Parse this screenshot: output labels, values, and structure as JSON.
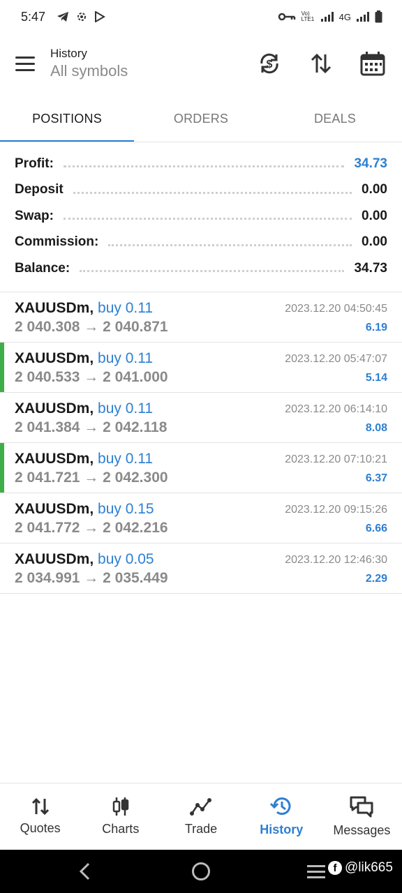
{
  "status_bar": {
    "time": "5:47",
    "network": "4G",
    "volte": "Vo) LTE1",
    "icons": [
      "telegram-icon",
      "settings-icon",
      "play-store-icon",
      "vpn-key-icon",
      "signal-icon",
      "battery-icon"
    ]
  },
  "header": {
    "title": "History",
    "subtitle": "All symbols",
    "actions": [
      "currency-exchange-icon",
      "sort-icon",
      "calendar-icon"
    ]
  },
  "tabs": [
    {
      "label": "POSITIONS",
      "active": true
    },
    {
      "label": "ORDERS",
      "active": false
    },
    {
      "label": "DEALS",
      "active": false
    }
  ],
  "summary": [
    {
      "label": "Profit:",
      "value": "34.73",
      "highlight": true
    },
    {
      "label": "Deposit",
      "value": "0.00",
      "highlight": false
    },
    {
      "label": "Swap:",
      "value": "0.00",
      "highlight": false
    },
    {
      "label": "Commission:",
      "value": "0.00",
      "highlight": false
    },
    {
      "label": "Balance:",
      "value": "34.73",
      "highlight": false
    }
  ],
  "positions": [
    {
      "symbol": "XAUUSDm,",
      "direction": "buy 0.11",
      "open": "2 040.308",
      "arrow": "→",
      "close": "2 040.871",
      "time": "2023.12.20 04:50:45",
      "profit": "6.19",
      "marked": false
    },
    {
      "symbol": "XAUUSDm,",
      "direction": "buy 0.11",
      "open": "2 040.533",
      "arrow": "→",
      "close": "2 041.000",
      "time": "2023.12.20 05:47:07",
      "profit": "5.14",
      "marked": true
    },
    {
      "symbol": "XAUUSDm,",
      "direction": "buy 0.11",
      "open": "2 041.384",
      "arrow": "→",
      "close": "2 042.118",
      "time": "2023.12.20 06:14:10",
      "profit": "8.08",
      "marked": false
    },
    {
      "symbol": "XAUUSDm,",
      "direction": "buy 0.11",
      "open": "2 041.721",
      "arrow": "→",
      "close": "2 042.300",
      "time": "2023.12.20 07:10:21",
      "profit": "6.37",
      "marked": true
    },
    {
      "symbol": "XAUUSDm,",
      "direction": "buy 0.15",
      "open": "2 041.772",
      "arrow": "→",
      "close": "2 042.216",
      "time": "2023.12.20 09:15:26",
      "profit": "6.66",
      "marked": false
    },
    {
      "symbol": "XAUUSDm,",
      "direction": "buy 0.05",
      "open": "2 034.991",
      "arrow": "→",
      "close": "2 035.449",
      "time": "2023.12.20 12:46:30",
      "profit": "2.29",
      "marked": false
    }
  ],
  "bottom_nav": [
    {
      "label": "Quotes",
      "icon": "quotes-icon",
      "active": false
    },
    {
      "label": "Charts",
      "icon": "charts-icon",
      "active": false
    },
    {
      "label": "Trade",
      "icon": "trade-icon",
      "active": false
    },
    {
      "label": "History",
      "icon": "history-icon",
      "active": true
    },
    {
      "label": "Messages",
      "icon": "messages-icon",
      "active": false
    }
  ],
  "watermark": "@lik665",
  "colors": {
    "accent": "#2d7fd2",
    "marker": "#3fae48",
    "muted": "#8a8a8a"
  }
}
